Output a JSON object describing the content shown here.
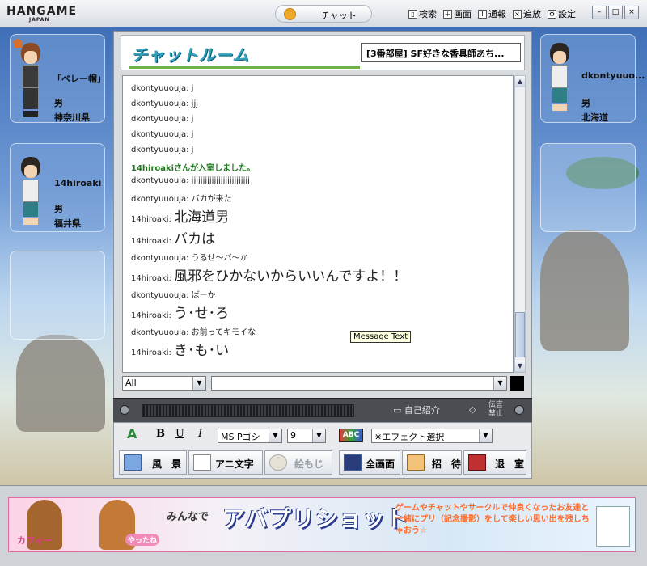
{
  "window": {
    "logo": "HANGAME",
    "logo_sub": "JAPAN",
    "active_tab": "チャット",
    "menu": [
      {
        "label": "検索",
        "icon": "search-icon"
      },
      {
        "label": "画面",
        "icon": "screen-icon"
      },
      {
        "label": "通報",
        "icon": "report-icon"
      },
      {
        "label": "追放",
        "icon": "kick-icon"
      },
      {
        "label": "設定",
        "icon": "settings-icon"
      }
    ],
    "controls": [
      "minimize",
      "restore",
      "close"
    ]
  },
  "left_profiles": [
    {
      "name": "「ベレー帽」",
      "gender": "男",
      "location": "神奈川県"
    },
    {
      "name": "14hiroaki",
      "gender": "男",
      "location": "福井県"
    }
  ],
  "right_profiles": [
    {
      "name": "dkontyuuo...",
      "gender": "男",
      "location": "北海道"
    }
  ],
  "chat": {
    "header_logo": "チャットルーム",
    "room_title": "[3番部屋] SF好きな香具師あち...",
    "messages": [
      {
        "who": "dkontyuuouja:",
        "text": "j",
        "style": "normal"
      },
      {
        "who": "dkontyuuouja:",
        "text": "jjj",
        "style": "normal"
      },
      {
        "who": "dkontyuuouja:",
        "text": "j",
        "style": "normal"
      },
      {
        "who": "dkontyuuouja:",
        "text": "j",
        "style": "normal"
      },
      {
        "who": "dkontyuuouja:",
        "text": "j",
        "style": "normal"
      },
      {
        "who": "",
        "text": "14hiroakiさんが入室しました。",
        "style": "sys"
      },
      {
        "who": "dkontyuuouja:",
        "text": "jjjjjjjjjjjjjjjjjjjjjjjjjj",
        "style": "normal"
      },
      {
        "who": "dkontyuuouja:",
        "text": "バカが来た",
        "style": "normal"
      },
      {
        "who": "14hiroaki:",
        "text": "北海道男",
        "style": "big"
      },
      {
        "who": "14hiroaki:",
        "text": "バカは",
        "style": "big"
      },
      {
        "who": "dkontyuuouja:",
        "text": "うるせ～バ～か",
        "style": "normal"
      },
      {
        "who": "14hiroaki:",
        "text": "風邪をひかないからいいんですよ！！",
        "style": "big"
      },
      {
        "who": "dkontyuuouja:",
        "text": "ばーか",
        "style": "normal"
      },
      {
        "who": "14hiroaki:",
        "text": "う･せ･ろ",
        "style": "big"
      },
      {
        "who": "dkontyuuouja:",
        "text": "お前ってキモイな",
        "style": "normal"
      },
      {
        "who": "14hiroaki:",
        "text": "き･も･い",
        "style": "big"
      }
    ],
    "tooltip": "Message Text",
    "target_select": "All",
    "input_value": ""
  },
  "strip": {
    "profile_label": "自己紹介",
    "dengon_line1": "伝言",
    "dengon_line2": "禁止"
  },
  "format": {
    "bold": "B",
    "underline": "U",
    "italic": "I",
    "font": "MS Pゴシ",
    "size": "9",
    "abc": "ABC",
    "effect": "※エフェクト選択"
  },
  "actions": [
    {
      "label": "風　景",
      "icon": "scenery-icon"
    },
    {
      "label": "アニ文字",
      "icon": "anime-text-icon"
    },
    {
      "label": "絵もじ",
      "icon": "emoji-icon"
    },
    {
      "label": "全画面",
      "icon": "fullscreen-icon"
    },
    {
      "label": "招　待",
      "icon": "invite-icon"
    },
    {
      "label": "退　室",
      "icon": "exit-icon"
    }
  ],
  "banner": {
    "lead": "みんなで",
    "title": "アバプリショット",
    "body": "ゲームやチャットやサークルで仲良くなったお友達と一緒にプリ（記念撮影）をして楽しい思い出を残しちゃおう☆",
    "tag_left": "カフィー",
    "tag_mid": "やったね"
  }
}
